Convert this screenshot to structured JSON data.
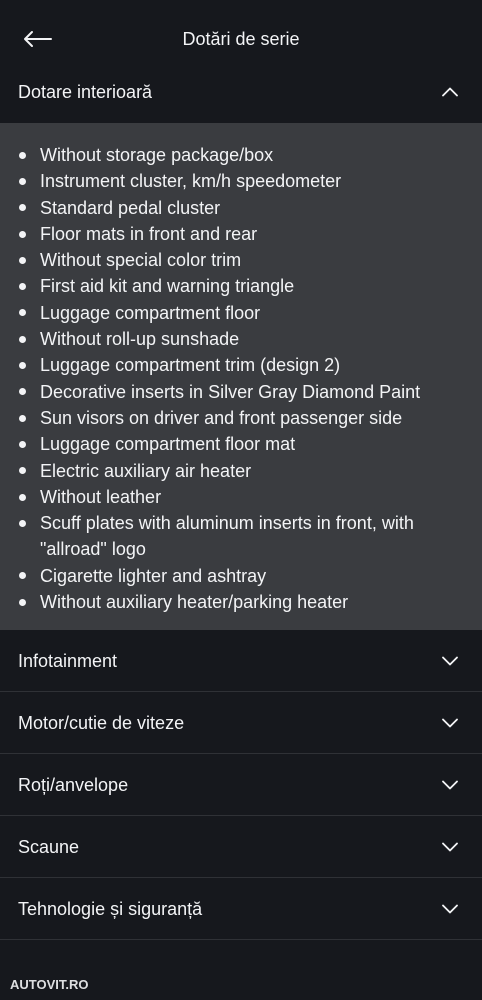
{
  "colors": {
    "background": "#16181d",
    "panel": "#3a3c40",
    "text": "#f3f4f6",
    "divider": "#2f3136"
  },
  "header": {
    "title": "Dotări de serie",
    "back_icon": "arrow-left-icon"
  },
  "sections": [
    {
      "title": "Dotare interioară",
      "expanded": true,
      "toggle_icon": "chevron-up-icon",
      "items": [
        "Without storage package/box",
        "Instrument cluster, km/h speedometer",
        "Standard pedal cluster",
        "Floor mats in front and rear",
        "Without special color trim",
        "First aid kit and warning triangle",
        "Luggage compartment floor",
        "Without roll-up sunshade",
        "Luggage compartment trim (design 2)",
        "Decorative inserts in Silver Gray Diamond Paint",
        "Sun visors on driver and front passenger side",
        "Luggage compartment floor mat",
        "Electric auxiliary air heater",
        "Without leather",
        "Scuff plates with aluminum inserts in front, with \"allroad\" logo",
        "Cigarette lighter and ashtray",
        "Without auxiliary heater/parking heater"
      ]
    },
    {
      "title": "Infotainment",
      "expanded": false,
      "toggle_icon": "chevron-down-icon"
    },
    {
      "title": "Motor/cutie de viteze",
      "expanded": false,
      "toggle_icon": "chevron-down-icon"
    },
    {
      "title": "Roți/anvelope",
      "expanded": false,
      "toggle_icon": "chevron-down-icon"
    },
    {
      "title": "Scaune",
      "expanded": false,
      "toggle_icon": "chevron-down-icon"
    },
    {
      "title": "Tehnologie și siguranță",
      "expanded": false,
      "toggle_icon": "chevron-down-icon"
    }
  ],
  "footer": {
    "logo_text": "AUTOVIT.RO"
  }
}
